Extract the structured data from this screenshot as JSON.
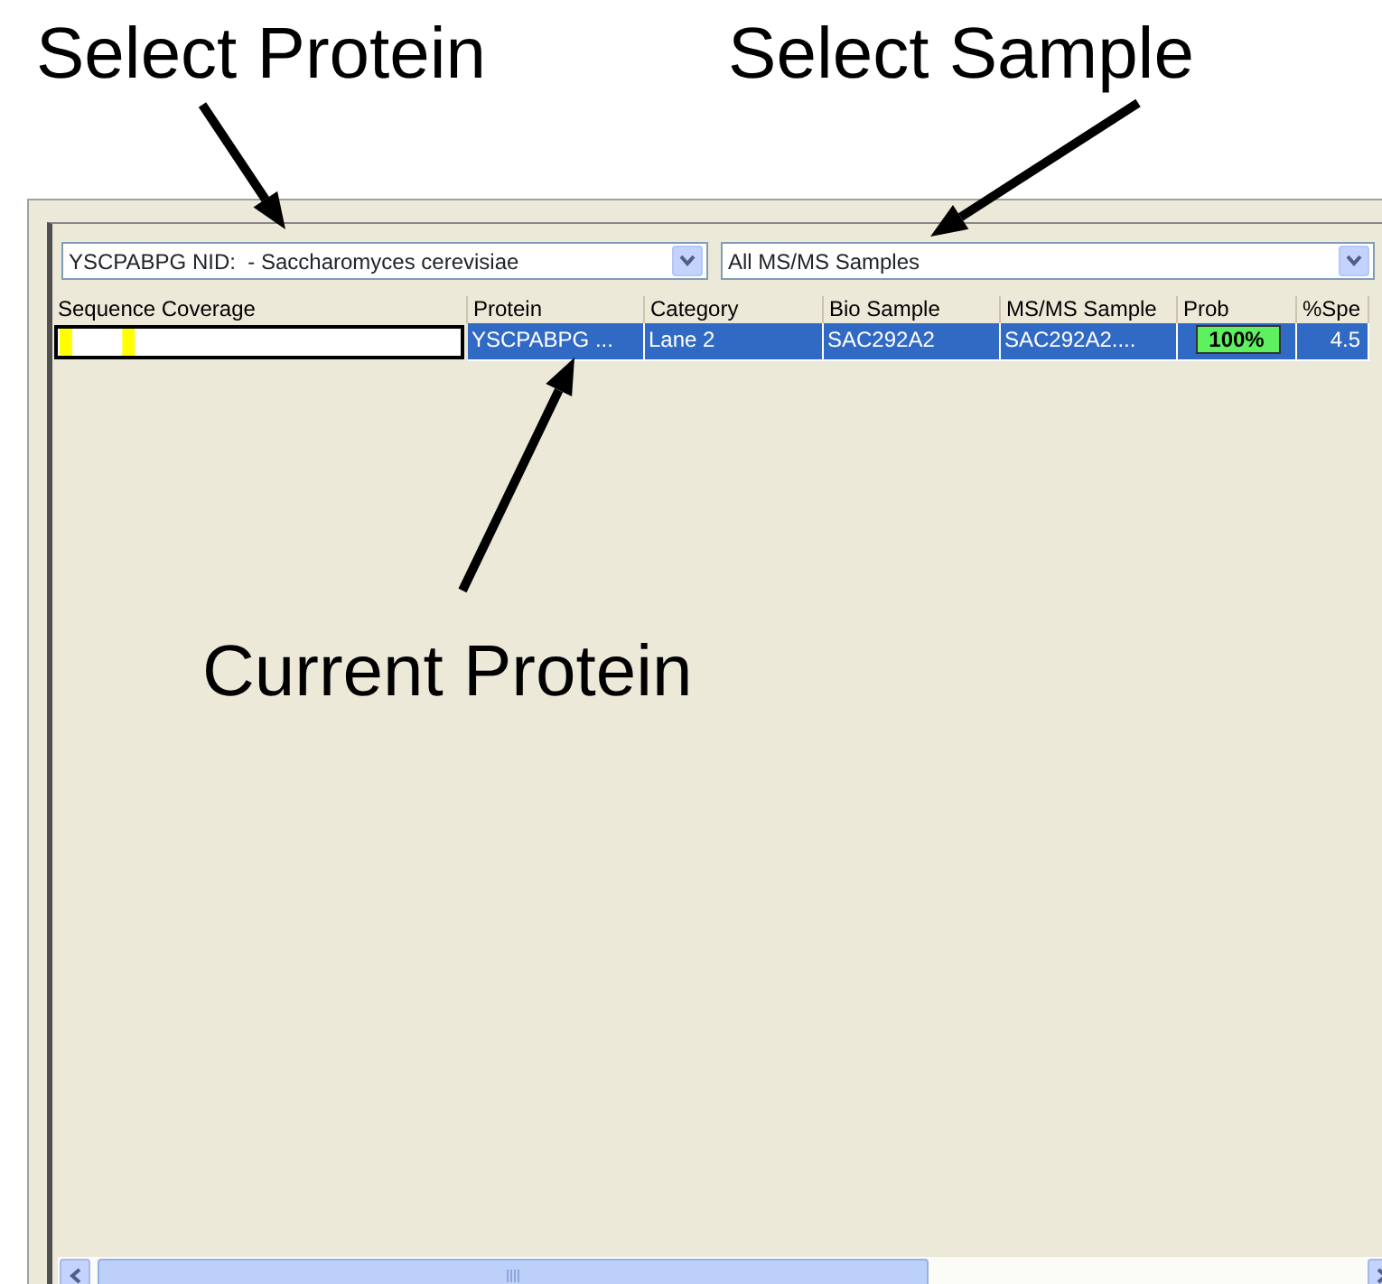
{
  "annotations": [
    {
      "kind": "title",
      "text": "Select Protein"
    },
    {
      "kind": "title",
      "text": "Select Sample"
    },
    {
      "kind": "callout",
      "text": "Current Protein"
    }
  ],
  "protein_select": {
    "value": "YSCPABPG NID:  - Saccharomyces cerevisiae"
  },
  "sample_select": {
    "value": "All MS/MS Samples"
  },
  "table": {
    "columns": [
      "Sequence Coverage",
      "Protein",
      "Category",
      "Bio Sample",
      "MS/MS Sample",
      "Prob",
      "%Spe"
    ],
    "rows": [
      {
        "selected": true,
        "cells": [
          {
            "kind": "coverage"
          },
          {
            "kind": "text",
            "text": "YSCPABPG ..."
          },
          {
            "kind": "text",
            "text": "Lane 2"
          },
          {
            "kind": "text",
            "text": "SAC292A2"
          },
          {
            "kind": "text",
            "text": "SAC292A2...."
          },
          {
            "kind": "prob",
            "text": "100%"
          },
          {
            "kind": "number",
            "text": "4.5"
          }
        ]
      }
    ]
  }
}
